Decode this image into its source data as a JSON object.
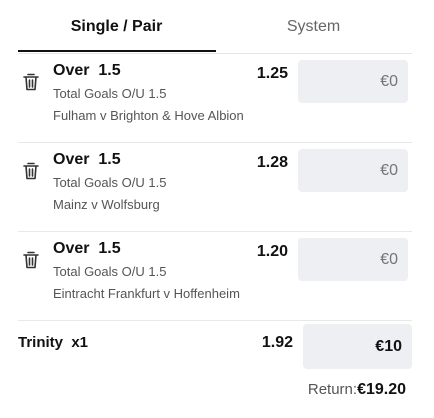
{
  "tabs": [
    {
      "label": "Single / Pair",
      "active": true
    },
    {
      "label": "System",
      "active": false
    }
  ],
  "bets": [
    {
      "selection": "Over  1.5",
      "market": "Total Goals O/U 1.5",
      "match": "Fulham v Brighton & Hove Albion",
      "odds": "1.25",
      "stake_placeholder": "€0"
    },
    {
      "selection": "Over  1.5",
      "market": "Total Goals O/U 1.5",
      "match": "Mainz v Wolfsburg",
      "odds": "1.28",
      "stake_placeholder": "€0"
    },
    {
      "selection": "Over  1.5",
      "market": "Total Goals O/U 1.5",
      "match": "Eintracht Frankfurt v Hoffenheim",
      "odds": "1.20",
      "stake_placeholder": "€0"
    }
  ],
  "combo": {
    "label": "Trinity  x1",
    "odds": "1.92",
    "stake": "€10"
  },
  "return": {
    "label": "Return:",
    "amount": "€19.20"
  },
  "icons": {
    "delete": "trash-icon"
  },
  "colors": {
    "input_bg": "#eeeff2",
    "text": "#111111",
    "muted": "#555555"
  }
}
